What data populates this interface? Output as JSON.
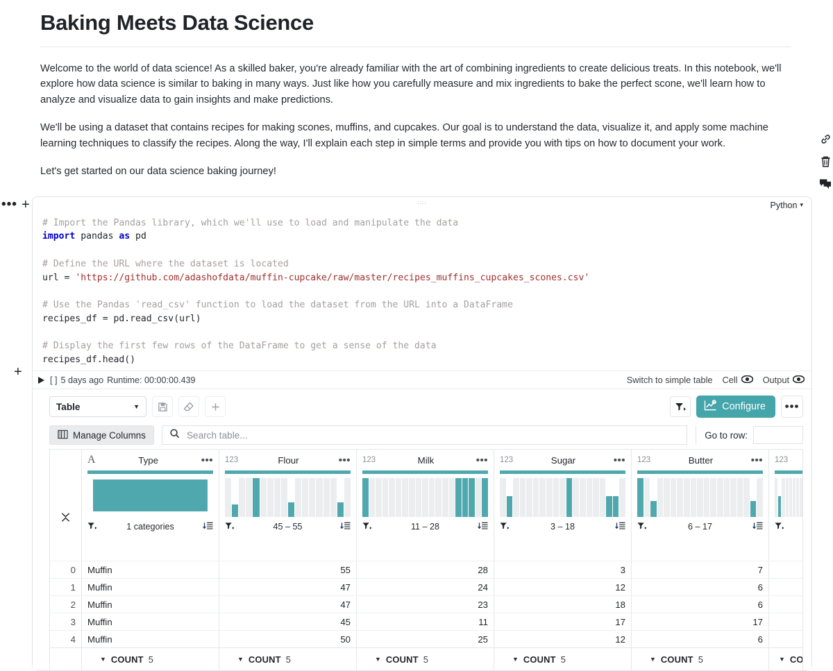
{
  "document": {
    "title": "Baking Meets Data Science",
    "paragraphs": [
      "Welcome to the world of data science! As a skilled baker, you're already familiar with the art of combining ingredients to create delicious treats. In this notebook, we'll explore how data science is similar to baking in many ways. Just like how you carefully measure and mix ingredients to bake the perfect scone, we'll learn how to analyze and visualize data to gain insights and make predictions.",
      "We'll be using a dataset that contains recipes for making scones, muffins, and cupcakes. Our goal is to understand the data, visualize it, and apply some machine learning techniques to classify the recipes. Along the way, I'll explain each step in simple terms and provide you with tips on how to document your work.",
      "Let's get started on our data science baking journey!"
    ]
  },
  "cell": {
    "language": "Python",
    "language_caret": "▾",
    "code_lines": [
      {
        "kind": "comment",
        "text": "# Import the Pandas library, which we'll use to load and manipulate the data"
      },
      {
        "kind": "import",
        "kw1": "import",
        "mid": " pandas ",
        "kw2": "as",
        "tail": " pd"
      },
      {
        "kind": "blank",
        "text": ""
      },
      {
        "kind": "comment",
        "text": "# Define the URL where the dataset is located"
      },
      {
        "kind": "assign-str",
        "pre": "url = ",
        "str": "'https://github.com/adashofdata/muffin-cupcake/raw/master/recipes_muffins_cupcakes_scones.csv'"
      },
      {
        "kind": "blank",
        "text": ""
      },
      {
        "kind": "comment",
        "text": "# Use the Pandas 'read_csv' function to load the dataset from the URL into a DataFrame"
      },
      {
        "kind": "plain",
        "text": "recipes_df = pd.read_csv(url)"
      },
      {
        "kind": "blank",
        "text": ""
      },
      {
        "kind": "comment",
        "text": "# Display the first few rows of the DataFrame to get a sense of the data"
      },
      {
        "kind": "plain",
        "text": "recipes_df.head()"
      }
    ],
    "status": {
      "execution_count": "[ ]",
      "last_run": "5 days ago",
      "runtime": "Runtime: 00:00:00.439",
      "switch_table": "Switch to simple table",
      "cell_label": "Cell",
      "output_label": "Output"
    }
  },
  "table_toolbar": {
    "view_select": "Table",
    "view_caret": "▼",
    "save_icon": "save-icon",
    "eraser_icon": "eraser-icon",
    "add_icon": "plus-icon",
    "filter_icon": "filter-icon",
    "configure_label": "Configure",
    "more_label": "•••",
    "accent_color": "#44a5aa"
  },
  "table_controls": {
    "manage_columns": "Manage Columns",
    "search_placeholder": "Search table...",
    "search_value": "",
    "goto_label": "Go to row:",
    "goto_value": ""
  },
  "chart_data": {
    "type": "table",
    "title": "recipes_df.head()",
    "index_header": "",
    "columns": [
      {
        "name": "Type",
        "dtype": "A",
        "dtype_label": "A",
        "stat": "1 categories",
        "kind": "categorical",
        "hist": []
      },
      {
        "name": "Flour",
        "dtype": "123",
        "dtype_label": "123",
        "stat": "45 – 55",
        "kind": "numeric",
        "hist": [
          0,
          28,
          0,
          0,
          100,
          0,
          0,
          0,
          0,
          38,
          0,
          0,
          0,
          0,
          0,
          0,
          38,
          0
        ]
      },
      {
        "name": "Milk",
        "dtype": "123",
        "dtype_label": "123",
        "stat": "11 – 28",
        "kind": "numeric",
        "hist": [
          100,
          0,
          0,
          0,
          0,
          0,
          0,
          0,
          0,
          0,
          0,
          0,
          0,
          0,
          100,
          100,
          100,
          0,
          100
        ]
      },
      {
        "name": "Sugar",
        "dtype": "123",
        "dtype_label": "123",
        "stat": "3 – 18",
        "kind": "numeric",
        "hist": [
          0,
          55,
          0,
          0,
          0,
          0,
          0,
          0,
          0,
          0,
          100,
          0,
          0,
          0,
          0,
          0,
          55,
          55,
          0
        ]
      },
      {
        "name": "Butter",
        "dtype": "123",
        "dtype_label": "123",
        "stat": "6 – 17",
        "kind": "numeric",
        "hist": [
          100,
          0,
          42,
          0,
          0,
          0,
          0,
          0,
          0,
          0,
          0,
          0,
          0,
          0,
          0,
          0,
          0,
          42,
          0
        ]
      },
      {
        "name": "",
        "dtype": "123",
        "dtype_label": "123",
        "stat": "",
        "kind": "numeric",
        "hist": [
          0,
          55,
          0,
          0,
          0,
          0,
          0,
          0,
          0,
          100
        ]
      }
    ],
    "rows": [
      {
        "index": "0",
        "values": [
          "Muffin",
          "55",
          "28",
          "3",
          "7",
          ""
        ]
      },
      {
        "index": "1",
        "values": [
          "Muffin",
          "47",
          "24",
          "12",
          "6",
          ""
        ]
      },
      {
        "index": "2",
        "values": [
          "Muffin",
          "47",
          "23",
          "18",
          "6",
          ""
        ]
      },
      {
        "index": "3",
        "values": [
          "Muffin",
          "45",
          "11",
          "17",
          "17",
          ""
        ]
      },
      {
        "index": "4",
        "values": [
          "Muffin",
          "50",
          "25",
          "12",
          "6",
          ""
        ]
      }
    ],
    "footer": [
      {
        "agg": "COUNT",
        "value": "5"
      },
      {
        "agg": "COUNT",
        "value": "5"
      },
      {
        "agg": "COUNT",
        "value": "5"
      },
      {
        "agg": "COUNT",
        "value": "5"
      },
      {
        "agg": "COUNT",
        "value": "5"
      },
      {
        "agg": "CO",
        "value": ""
      }
    ]
  },
  "rail": {
    "link_icon": "link-icon",
    "trash_icon": "trash-icon",
    "comment_icon": "comment-icon"
  },
  "gutter": {
    "more_icon": "•••",
    "add_icon": "+",
    "add_below_icon": "+"
  }
}
